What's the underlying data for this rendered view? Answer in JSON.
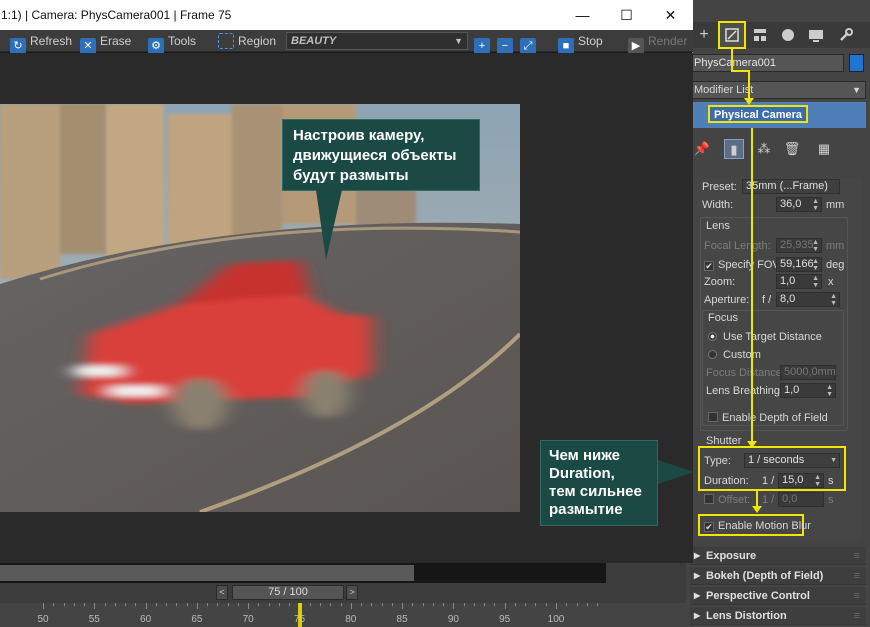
{
  "framebuffer": {
    "title": "1:1) | Camera: PhysCamera001 | Frame 75",
    "window_controls": {
      "minimize": "—",
      "maximize": "☐",
      "close": "✕"
    },
    "toolbar": {
      "refresh": "Refresh",
      "erase": "Erase",
      "tools": "Tools",
      "region": "Region",
      "channel": "BEAUTY",
      "stop": "Stop",
      "render": "Render"
    }
  },
  "callouts": {
    "top": [
      "Настроив камеру,",
      "движущиеся объекты",
      "будут размыты"
    ],
    "bottom": [
      "Чем ниже",
      "Duration,",
      "тем сильнее",
      "размытие"
    ]
  },
  "panel": {
    "object_name": "PhysCamera001",
    "modifier_list": "Modifier List",
    "stack_item": "Physical Camera",
    "preset_label": "Preset:",
    "preset_value": "35mm (...Frame)",
    "width_label": "Width:",
    "width_value": "36,0",
    "width_unit": "mm",
    "lens_title": "Lens",
    "focal_label": "Focal Length:",
    "focal_value": "25,935",
    "focal_unit": "mm",
    "fov_label": "Specify FOV:",
    "fov_value": "59,166",
    "fov_unit": "deg",
    "zoom_label": "Zoom:",
    "zoom_value": "1,0",
    "zoom_unit": "x",
    "aperture_label": "Aperture:",
    "aperture_prefix": "f /",
    "aperture_value": "8,0",
    "focus_title": "Focus",
    "focus_target": "Use Target Distance",
    "focus_custom": "Custom",
    "focus_distance_label": "Focus Distance:",
    "focus_distance_value": "5000,0mm",
    "lens_breathing_label": "Lens Breathing:",
    "lens_breathing_value": "1,0",
    "enable_dof": "Enable Depth of Field",
    "shutter_title": "Shutter",
    "type_label": "Type:",
    "type_value": "1 / seconds",
    "duration_label": "Duration:",
    "duration_prefix": "1 /",
    "duration_value": "15,0",
    "duration_unit": "s",
    "offset_label": "Offset:",
    "offset_prefix": "1 /",
    "offset_value": "0,0",
    "offset_unit": "s",
    "enable_motion_blur": "Enable Motion Blur",
    "rollouts": [
      "Exposure",
      "Bokeh (Depth of Field)",
      "Perspective Control",
      "Lens Distortion"
    ]
  },
  "timeline": {
    "frame_counter": "75 / 100",
    "current_frame": 75,
    "ticks": [
      "50",
      "55",
      "60",
      "65",
      "70",
      "75",
      "80",
      "85",
      "90",
      "95",
      "100"
    ]
  },
  "colors": {
    "highlight": "#f0e600",
    "callout_bg": "#1b4a45",
    "car": "#d9403a"
  }
}
